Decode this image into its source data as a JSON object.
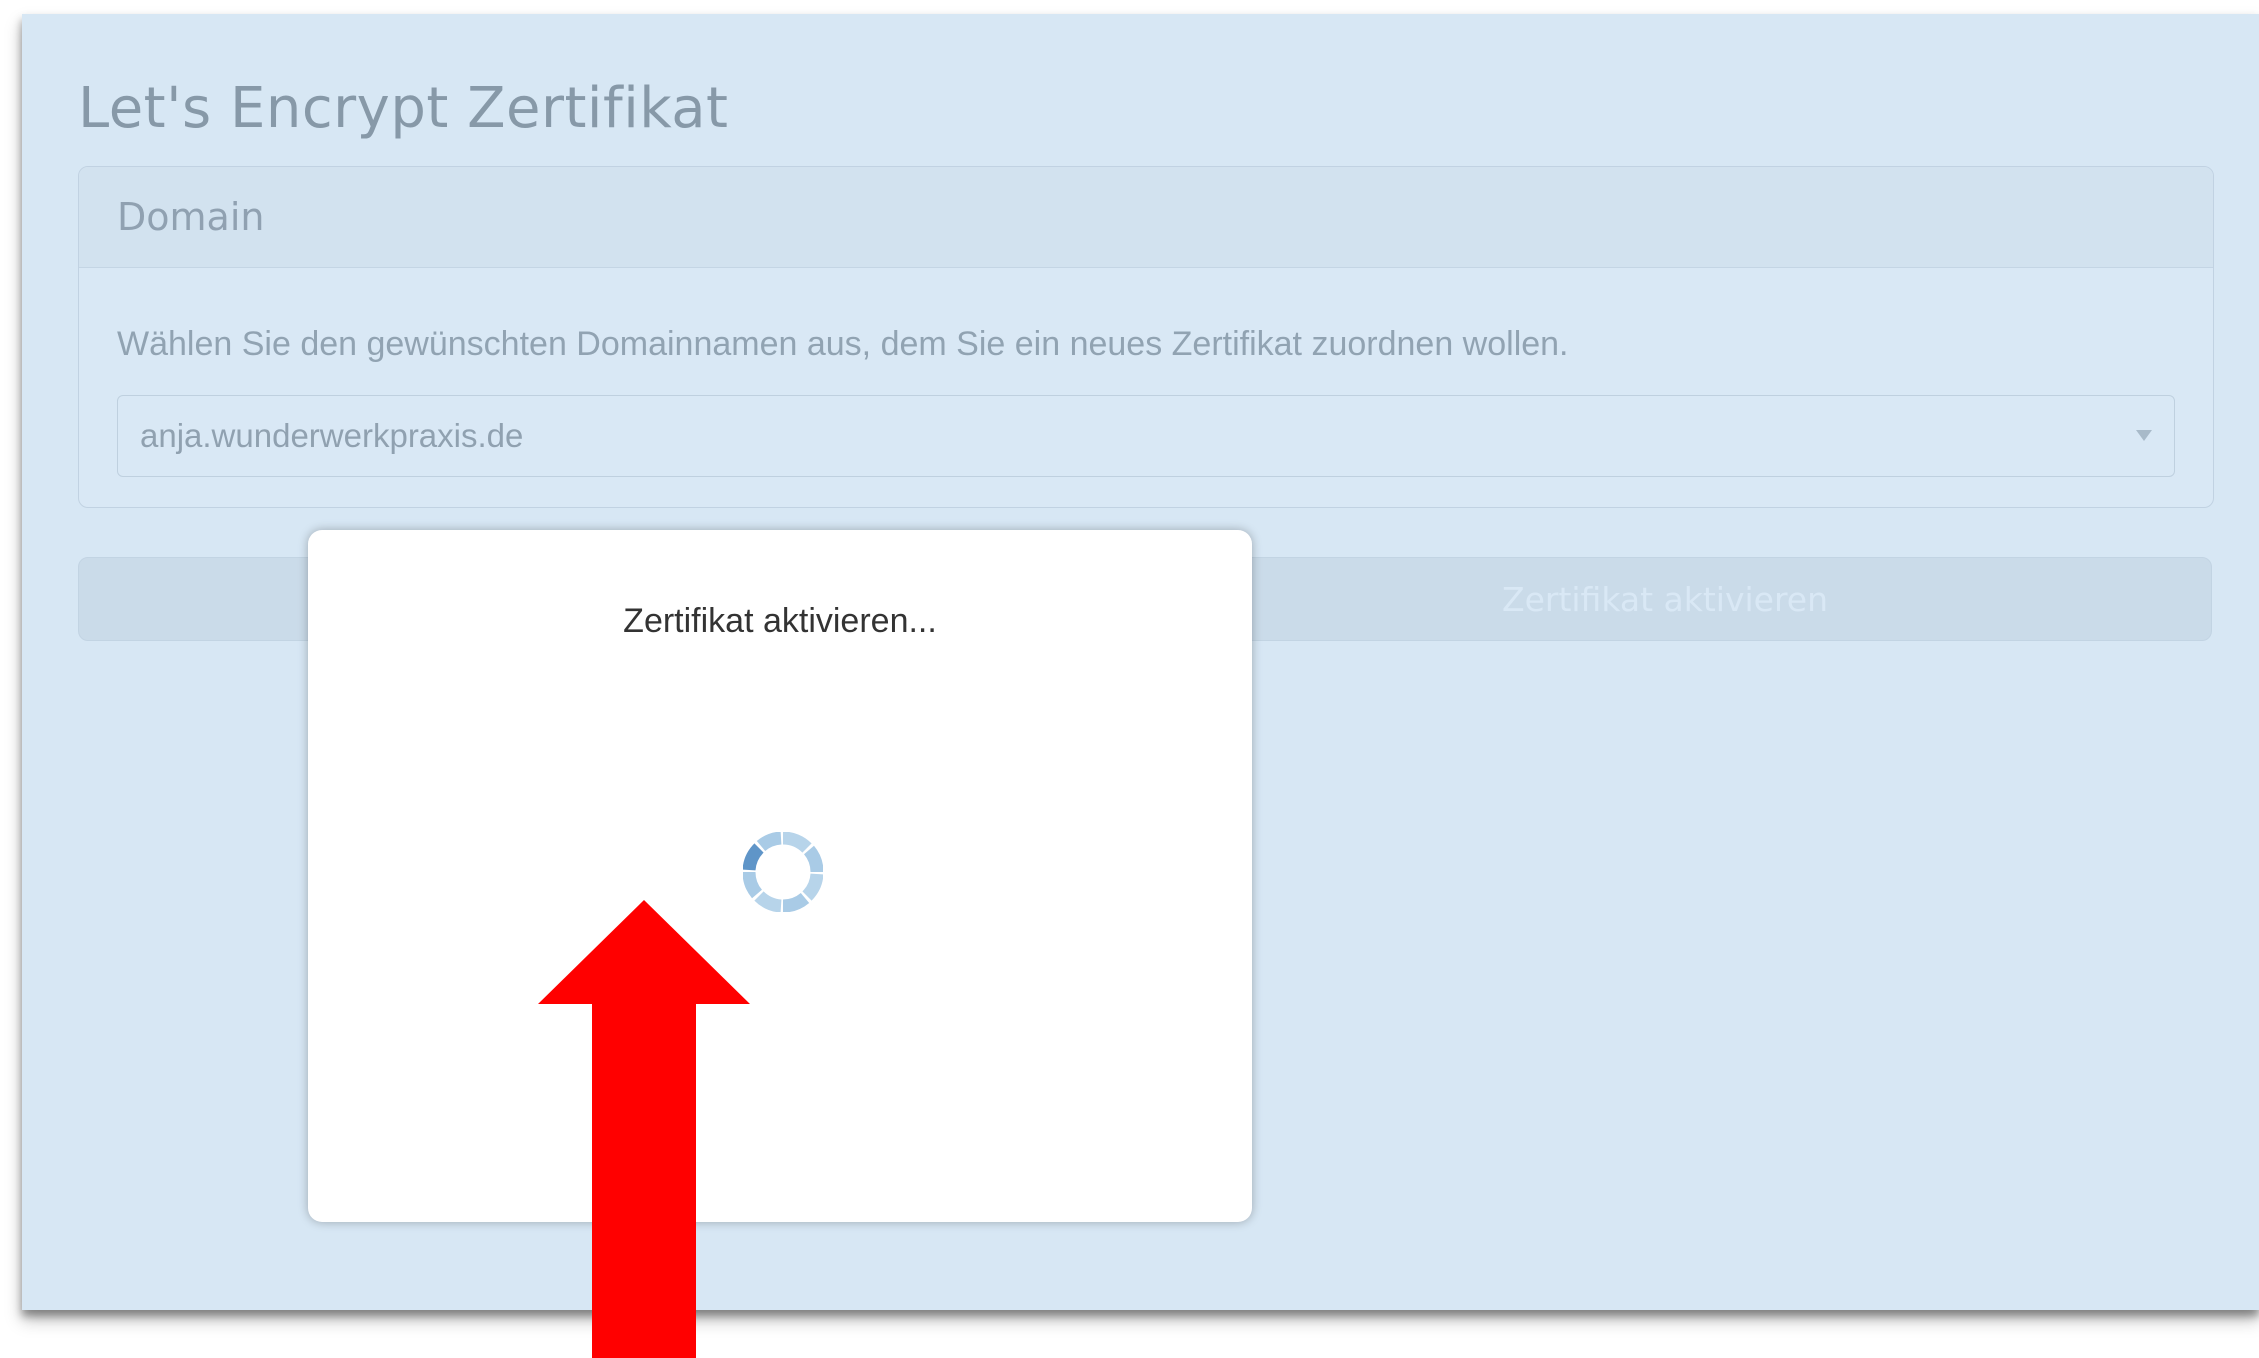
{
  "page": {
    "title": "Let's Encrypt Zertifikat"
  },
  "domain_panel": {
    "header": "Domain",
    "description": "Wählen Sie den gewünschten Domainnamen aus, dem Sie ein neues Zertifikat zuordnen wollen.",
    "select_value": "anja.wunderwerkpraxis.de"
  },
  "action": {
    "button_label": "Zertifikat aktivieren"
  },
  "modal": {
    "title": "Zertifikat aktivieren..."
  },
  "icons": {
    "spinner": "loading-spinner-icon",
    "caret": "chevron-down-icon",
    "annotation": "red-up-arrow-icon"
  },
  "colors": {
    "overlay": "#aacde8",
    "spinner_light": "#b7d4ea",
    "spinner_dark": "#5f95c8",
    "arrow": "#ff0000"
  }
}
